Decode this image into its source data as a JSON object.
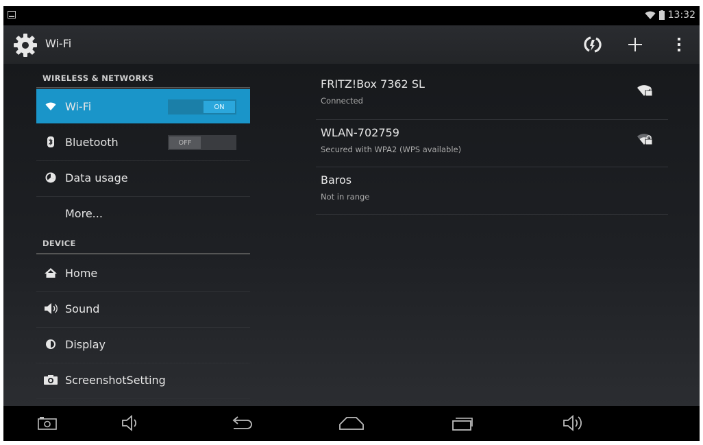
{
  "status_bar": {
    "time": "13:32"
  },
  "action_bar": {
    "title": "Wi-Fi"
  },
  "sidebar": {
    "wireless_category": "WIRELESS & NETWORKS",
    "device_category": "DEVICE",
    "items": [
      {
        "label": "Wi-Fi",
        "toggle": "ON"
      },
      {
        "label": "Bluetooth",
        "toggle": "OFF"
      },
      {
        "label": "Data usage"
      },
      {
        "label": "More..."
      },
      {
        "label": "Home"
      },
      {
        "label": "Sound"
      },
      {
        "label": "Display"
      },
      {
        "label": "ScreenshotSetting"
      }
    ]
  },
  "networks": [
    {
      "name": "FRITZ!Box 7362 SL",
      "status": "Connected",
      "signal_icon": "wifi-lock-icon"
    },
    {
      "name": "WLAN-702759",
      "status": "Secured with WPA2 (WPS available)",
      "signal_icon": "wifi-lock-icon"
    },
    {
      "name": "Baros",
      "status": "Not in range"
    }
  ],
  "colors": {
    "accent": "#1a95c9",
    "background": "#1b1d20"
  }
}
